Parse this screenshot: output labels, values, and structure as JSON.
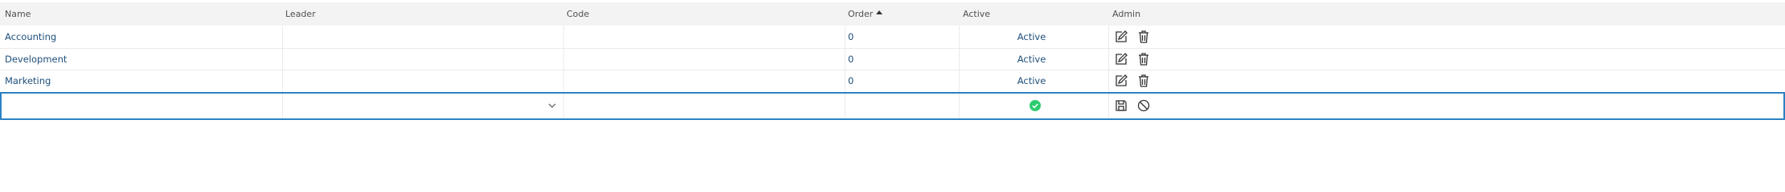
{
  "table": {
    "columns": {
      "name": "Name",
      "leader": "Leader",
      "code": "Code",
      "order": "Order",
      "active": "Active",
      "admin": "Admin"
    },
    "sort": {
      "column": "Order",
      "direction": "ascending",
      "icon": "sort-ascending-icon"
    },
    "rows": [
      {
        "name": "Accounting",
        "leader": "",
        "code": "",
        "order": "0",
        "active": "Active"
      },
      {
        "name": "Development",
        "leader": "",
        "code": "",
        "order": "0",
        "active": "Active"
      },
      {
        "name": "Marketing",
        "leader": "",
        "code": "",
        "order": "0",
        "active": "Active"
      }
    ],
    "row_actions": {
      "edit_icon": "edit-icon",
      "delete_icon": "trash-icon"
    },
    "new_row": {
      "name_value": "",
      "leader_value": "",
      "code_value": "",
      "order_value": "",
      "active_icon": "check-circle-icon",
      "save_icon": "save-icon",
      "cancel_icon": "cancel-icon"
    }
  },
  "colors": {
    "link": "#1e4f7c",
    "header_bg": "#f3f3f3",
    "edit_outline": "#2b82c4",
    "active_check": "#2ecc71"
  }
}
